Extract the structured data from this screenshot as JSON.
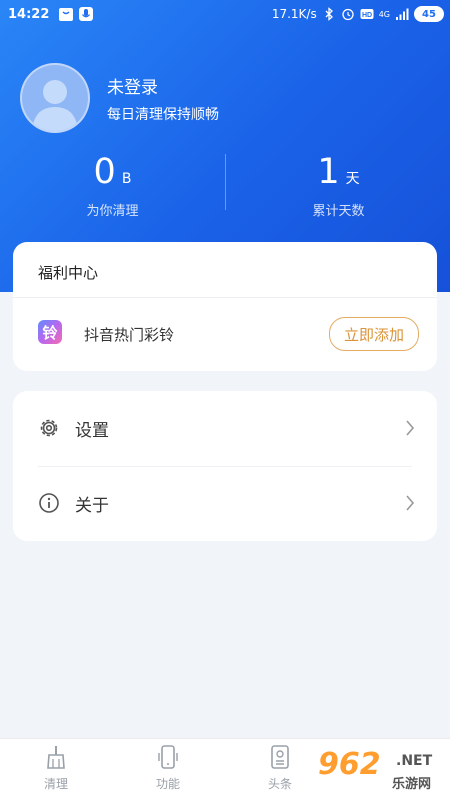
{
  "status_bar": {
    "time": "14:22",
    "speed": "17.1K/s",
    "network": "4G",
    "battery": "45"
  },
  "profile": {
    "name": "未登录",
    "subtitle": "每日清理保持顺畅"
  },
  "stats": {
    "cleaned": {
      "value": "0",
      "unit": "B",
      "label": "为你清理"
    },
    "days": {
      "value": "1",
      "unit": "天",
      "label": "累计天数"
    }
  },
  "welfare": {
    "title": "福利中心",
    "item_icon_char": "铃",
    "item_label": "抖音热门彩铃",
    "button_label": "立即添加"
  },
  "menu": {
    "settings_label": "设置",
    "about_label": "关于"
  },
  "tabs": [
    {
      "label": "清理",
      "icon": "broom-icon"
    },
    {
      "label": "功能",
      "icon": "phone-icon"
    },
    {
      "label": "头条",
      "icon": "news-icon"
    }
  ],
  "watermark": {
    "number": "962",
    "suffix": ".NET",
    "text": "乐游网"
  },
  "colors": {
    "header_blue": "#1f6ff0",
    "button_orange": "#d99338",
    "page_bg": "#f1f4f8"
  }
}
